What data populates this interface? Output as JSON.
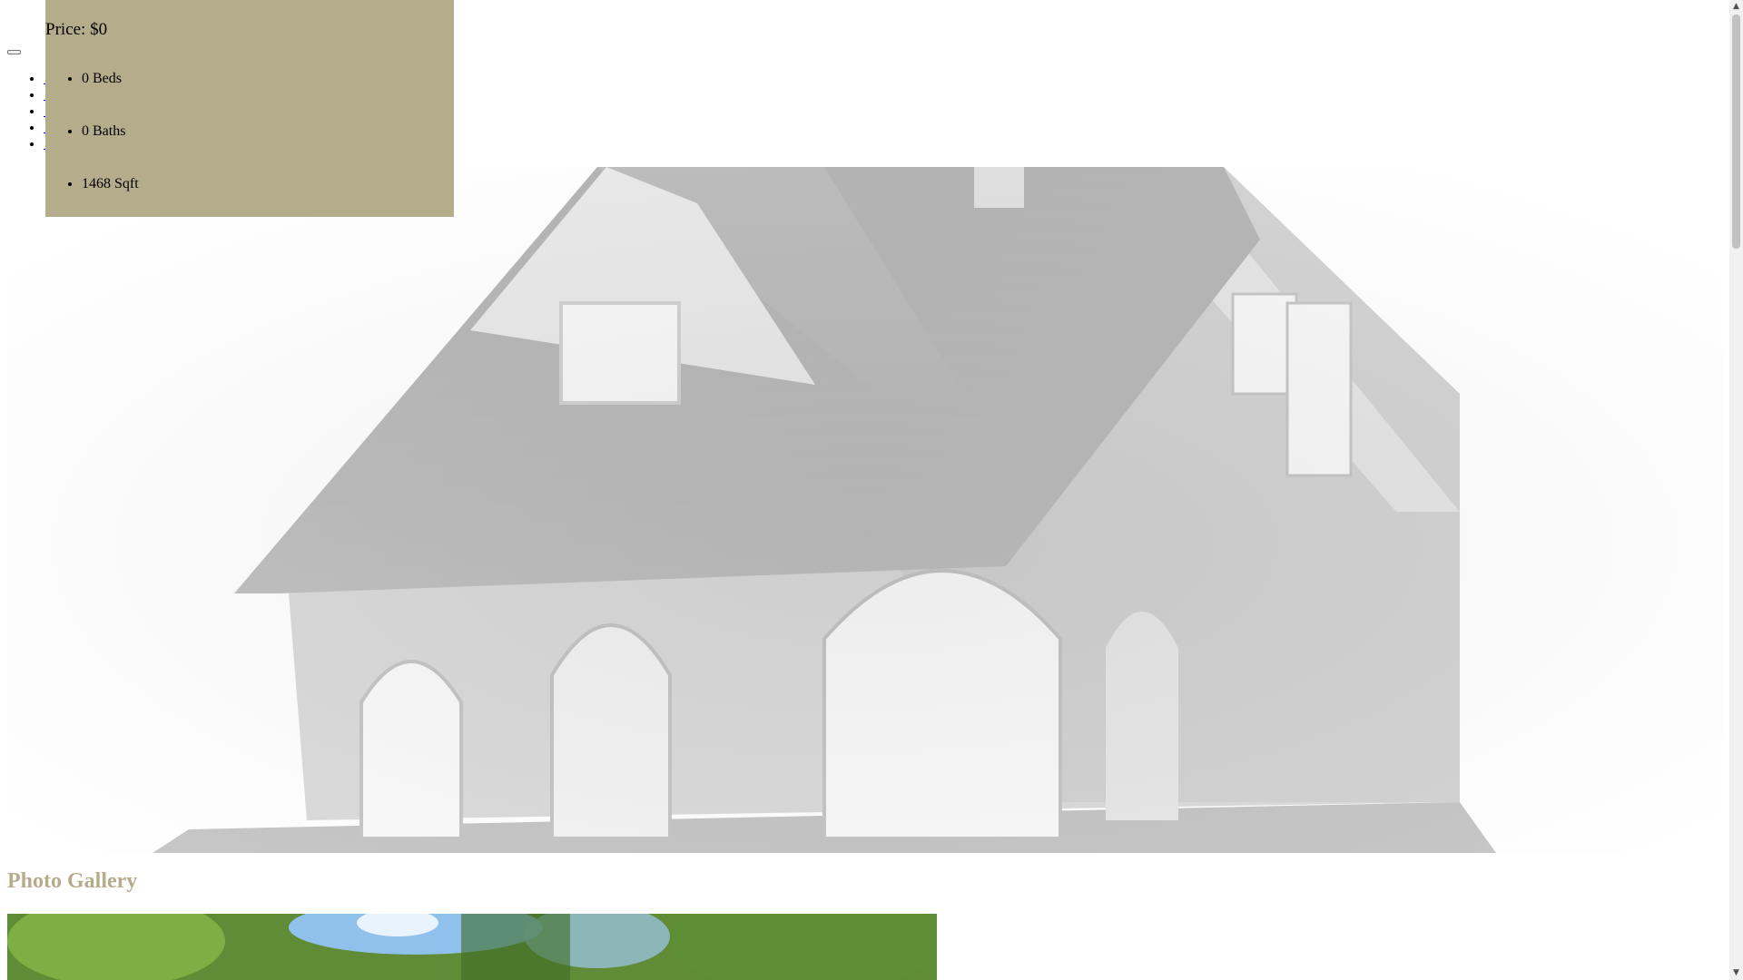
{
  "listing": {
    "price": "Price: $0",
    "features": [
      {
        "label": "0 Beds"
      },
      {
        "label": "0 Baths"
      },
      {
        "label": "1468 Sqft"
      }
    ]
  },
  "nav": {
    "items": [
      {
        "label": ""
      },
      {
        "label": ""
      },
      {
        "label": ""
      },
      {
        "label": ""
      },
      {
        "label": ""
      }
    ]
  },
  "gallery": {
    "title": "Photo Gallery"
  },
  "icons": {
    "menu": "hamburger-icon",
    "scroll_up": "chevron-up-icon",
    "scroll_down": "chevron-down-icon"
  },
  "colors": {
    "accent": "#b5ac8c",
    "link": "#0000ee",
    "scrollbar_track": "#f1f1f1",
    "scrollbar_thumb": "#c1c1c1"
  }
}
